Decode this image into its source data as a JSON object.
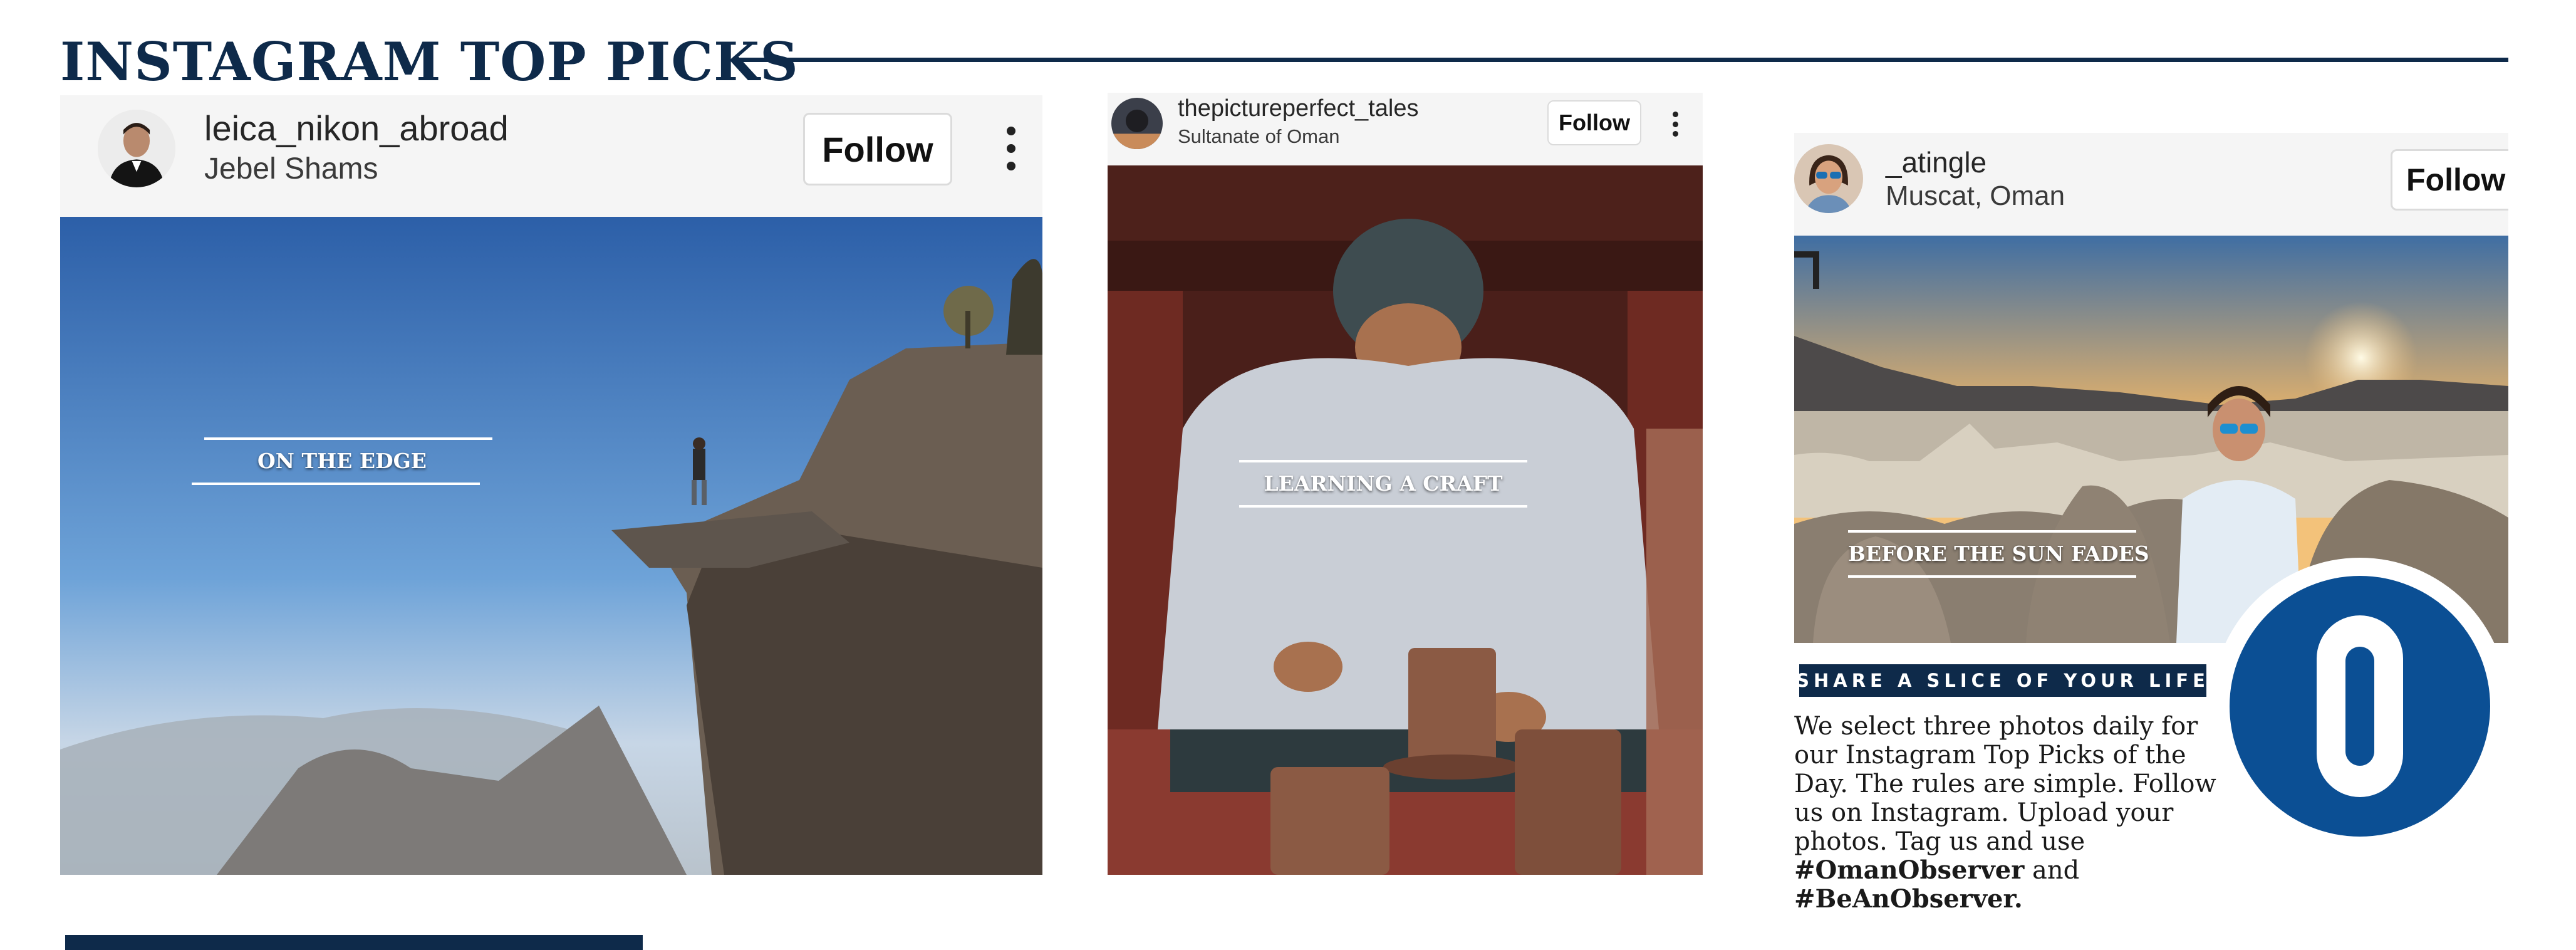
{
  "header": {
    "title": "INSTAGRAM TOP PICKS"
  },
  "posts": [
    {
      "username": "leica_nikon_abroad",
      "location": "Jebel Shams",
      "follow_label": "Follow",
      "caption": "ON THE EDGE"
    },
    {
      "username": "thepictureperfect_tales",
      "location": "Sultanate of Oman",
      "follow_label": "Follow",
      "caption": "LEARNING A CRAFT"
    },
    {
      "username": "_atingle",
      "location": "Muscat, Oman",
      "follow_label": "Follow",
      "caption": "BEFORE THE SUN FADES"
    }
  ],
  "promo": {
    "banner": "SHARE A SLICE OF YOUR LIFE",
    "body_lines": [
      "We select three photos daily for",
      "our Instagram Top Picks of the",
      "Day. The rules are simple. Follow",
      "us on Instagram. Upload your",
      "photos. Tag us and use"
    ],
    "hashtag_1": "#OmanObserver",
    "joiner": "and",
    "hashtag_2": "#BeAnObserver."
  },
  "logo": {
    "letter": "O",
    "color": "#0b4f94"
  },
  "colors": {
    "navy": "#0e2a4a",
    "logo_blue": "#0b4f94"
  },
  "icons": [
    "avatar",
    "kebab-menu-icon"
  ]
}
